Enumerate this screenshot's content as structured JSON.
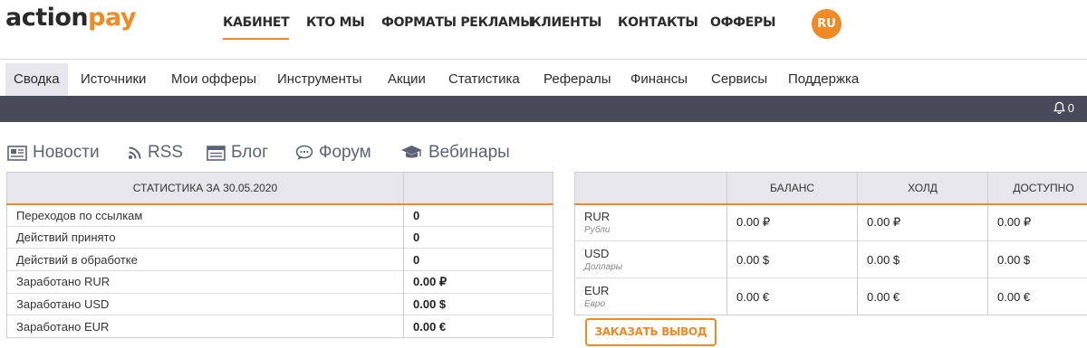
{
  "brand": {
    "part1": "action",
    "part2": "pay",
    "accent": "#f08a24"
  },
  "topnav": [
    "КАБИНЕТ",
    "КТО МЫ",
    "ФОРМАТЫ РЕКЛАМЫ",
    "КЛИЕНТЫ",
    "КОНТАКТЫ",
    "ОФФЕРЫ"
  ],
  "lang": "RU",
  "submenu": [
    "Сводка",
    "Источники",
    "Мои офферы",
    "Инструменты",
    "Акции",
    "Статистика",
    "Рефералы",
    "Финансы",
    "Сервисы",
    "Поддержка"
  ],
  "notifications": {
    "icon": "bell-icon",
    "count": "0"
  },
  "quicklinks": [
    {
      "label": "Новости",
      "icon": "newspaper-icon"
    },
    {
      "label": "RSS",
      "icon": "rss-icon"
    },
    {
      "label": "Блог",
      "icon": "blog-icon"
    },
    {
      "label": "Форум",
      "icon": "chat-bubble-icon"
    },
    {
      "label": "Вебинары",
      "icon": "graduation-cap-icon"
    }
  ],
  "stats": {
    "header": "СТАТИСТИКА ЗА 30.05.2020",
    "rows": [
      {
        "label": "Переходов по ссылкам",
        "value": "0"
      },
      {
        "label": "Действий принято",
        "value": "0"
      },
      {
        "label": "Действий в обработке",
        "value": "0"
      },
      {
        "label": "Заработано RUR",
        "value": "0.00 ₽"
      },
      {
        "label": "Заработано USD",
        "value": "0.00 $"
      },
      {
        "label": "Заработано EUR",
        "value": "0.00 €"
      }
    ]
  },
  "balance": {
    "headers": [
      "БАЛАНС",
      "ХОЛД",
      "ДОСТУПНО"
    ],
    "rows": [
      {
        "code": "RUR",
        "name": "Рубли",
        "balance": "0.00 ₽",
        "hold": "0.00 ₽",
        "available": "0.00 ₽"
      },
      {
        "code": "USD",
        "name": "Доллары",
        "balance": "0.00 $",
        "hold": "0.00 $",
        "available": "0.00 $"
      },
      {
        "code": "EUR",
        "name": "Евро",
        "balance": "0.00 €",
        "hold": "0.00 €",
        "available": "0.00 €"
      }
    ]
  },
  "withdraw_button": "ЗАКАЗАТЬ ВЫВОД"
}
